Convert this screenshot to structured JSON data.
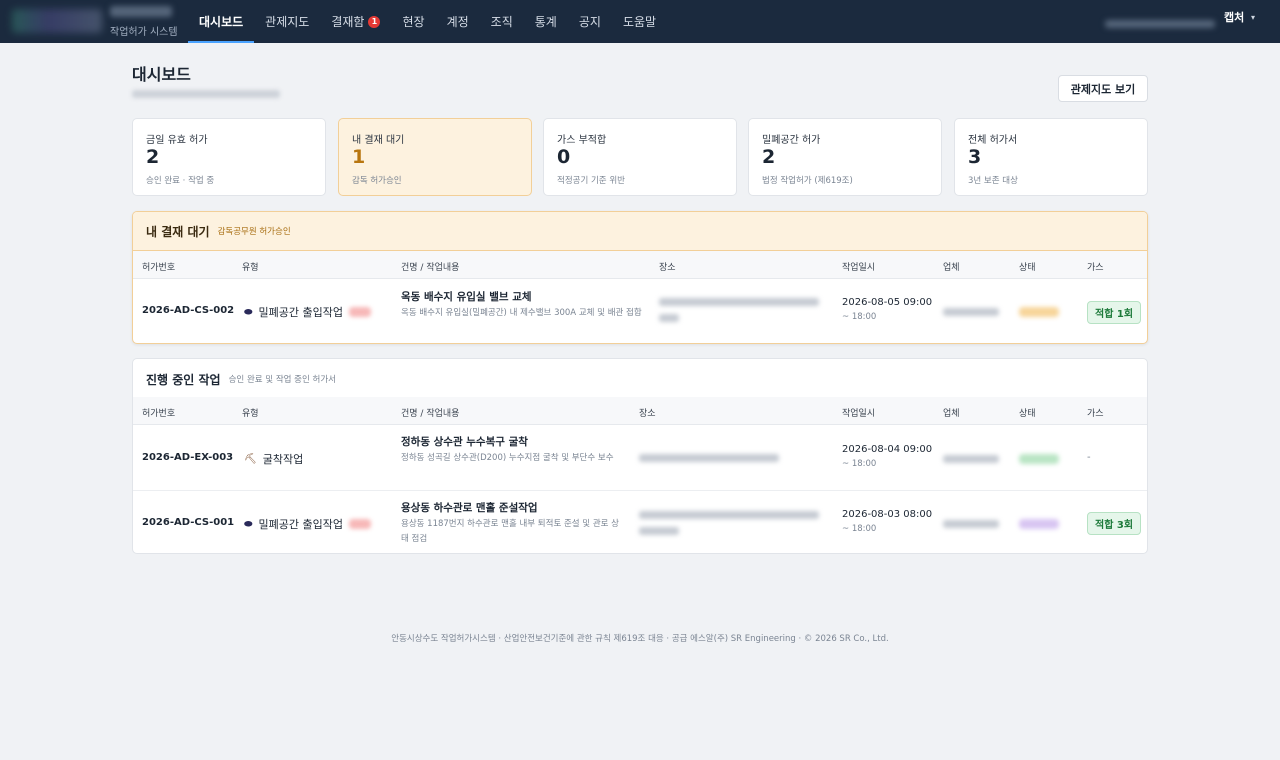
{
  "nav": {
    "system_subtitle": "작업허가 시스템",
    "items": [
      {
        "label": "대시보드",
        "active": true
      },
      {
        "label": "관제지도"
      },
      {
        "label": "결재함",
        "badge": "1"
      },
      {
        "label": "현장"
      },
      {
        "label": "계정"
      },
      {
        "label": "조직"
      },
      {
        "label": "통계"
      },
      {
        "label": "공지"
      },
      {
        "label": "도움말"
      }
    ],
    "user_name": "캡처"
  },
  "page": {
    "title": "대시보드",
    "map_button": "관제지도 보기"
  },
  "stats": [
    {
      "label": "금일 유효 허가",
      "value": "2",
      "hint": "승인 완료 · 작업 중"
    },
    {
      "label": "내 결재 대기",
      "value": "1",
      "hint": "감독 허가승인"
    },
    {
      "label": "가스 부적합",
      "value": "0",
      "hint": "적정공기 기준 위반"
    },
    {
      "label": "밀폐공간 허가",
      "value": "2",
      "hint": "법정 작업허가 (제619조)"
    },
    {
      "label": "전체 허가서",
      "value": "3",
      "hint": "3년 보존 대상"
    }
  ],
  "pending": {
    "title": "내 결재 대기",
    "subtitle": "감독공무원 허가승인",
    "columns": [
      "허가번호",
      "유형",
      "건명 / 작업내용",
      "장소",
      "작업일시",
      "업체",
      "상태",
      "가스"
    ],
    "rows": [
      {
        "permit_no": "2026-AD-CS-002",
        "type": "밀폐공간 출입작업",
        "title": "옥동 배수지 유입실 밸브 교체",
        "desc": "옥동 배수지 유입실(밀폐공간) 내 제수밸브 300A 교체 및 배관 접합",
        "date": "2026-08-05 09:00",
        "end": "~ 18:00",
        "gas": "적합 1회"
      }
    ]
  },
  "active": {
    "title": "진행 중인 작업",
    "subtitle": "승인 완료 및 작업 중인 허가서",
    "columns": [
      "허가번호",
      "유형",
      "건명 / 작업내용",
      "장소",
      "작업일시",
      "업체",
      "상태",
      "가스"
    ],
    "rows": [
      {
        "permit_no": "2026-AD-EX-003",
        "type": "굴착작업",
        "title": "정하동 상수관 누수복구 굴착",
        "desc": "정하동 성곡길 상수관(D200) 누수지점 굴착 및 부단수 보수",
        "date": "2026-08-04 09:00",
        "end": "~ 18:00",
        "gas": "-"
      },
      {
        "permit_no": "2026-AD-CS-001",
        "type": "밀폐공간 출입작업",
        "title": "용상동 하수관로 맨홀 준설작업",
        "desc": "용상동 1187번지 하수관로 맨홀 내부 퇴적토 준설 및 관로 상태 점검",
        "date": "2026-08-03 08:00",
        "end": "~ 18:00",
        "gas": "적합 3회"
      }
    ]
  },
  "footer": "안동시상수도 작업허가시스템 · 산업안전보건기준에 관한 규칙 제619조 대응 · 공급 에스알(주) SR Engineering · © 2026 SR Co., Ltd."
}
